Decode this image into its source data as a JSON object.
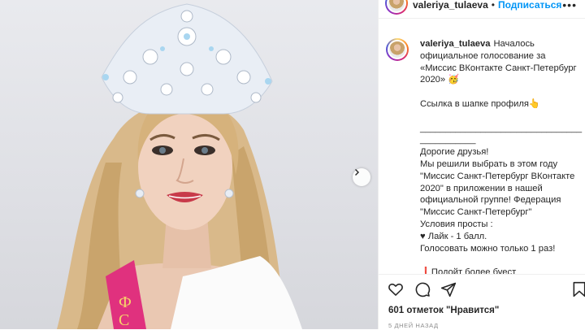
{
  "post": {
    "username": "valeriya_tulaeva",
    "follow_label": "Подписаться",
    "separator": "•",
    "more_icon": "more-horizontal-icon",
    "caption": "Началось официальное голосование за «Миссис ВКонтакте Санкт-Петербург 2020» 🥳\n\nСсылка в шапке профиля👆\n\n___________________________________________\nДорогие друзья!\nМы решили выбрать в этом году \"Миссис Санкт-Петербург ВКонтакте 2020\" в приложении в нашей официальной группе! Федерация \"Миссис Санкт-Петербург\"\nУсловия просты :\n♥ Лайк - 1 балл.\nГолосовать можно только 1 раз!\n\n❗Подойт более буест",
    "likes_text": "601 отметок \"Нравится\"",
    "time_ago": "5 ДНЕЙ НАЗАД"
  },
  "photo": {
    "sash_text": "ФИ\nСЕ",
    "next_icon": "chevron-right-icon"
  },
  "icons": {
    "like": "heart-icon",
    "comment": "comment-icon",
    "share": "paper-plane-icon",
    "save": "bookmark-icon"
  },
  "colors": {
    "accent": "#0095f6",
    "text": "#262626",
    "muted": "#8e8e8e",
    "sash": "#e0317e"
  }
}
